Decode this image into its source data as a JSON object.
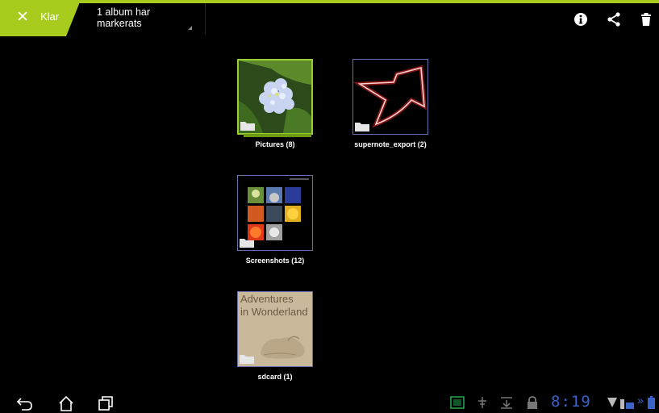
{
  "actionbar": {
    "done_label": "Klar",
    "selection_text_line1": "1 album har",
    "selection_text_line2": "markerats",
    "accent_color": "#a7cc1e"
  },
  "albums": [
    {
      "caption": "Pictures (8)",
      "selected": true
    },
    {
      "caption": "supernote_export (2)",
      "selected": false
    },
    {
      "caption": "Screenshots (12)",
      "selected": false
    },
    {
      "caption": "sdcard (1)",
      "selected": false,
      "cover_text_line1": "Adventures",
      "cover_text_line2": "in Wonderland"
    }
  ],
  "statusbar": {
    "time": "8:19",
    "icons": [
      "gallery-icon",
      "usb-debug-icon",
      "download-icon",
      "lock-icon",
      "wifi-icon",
      "battery-dock-icon",
      "battery-icon"
    ]
  }
}
